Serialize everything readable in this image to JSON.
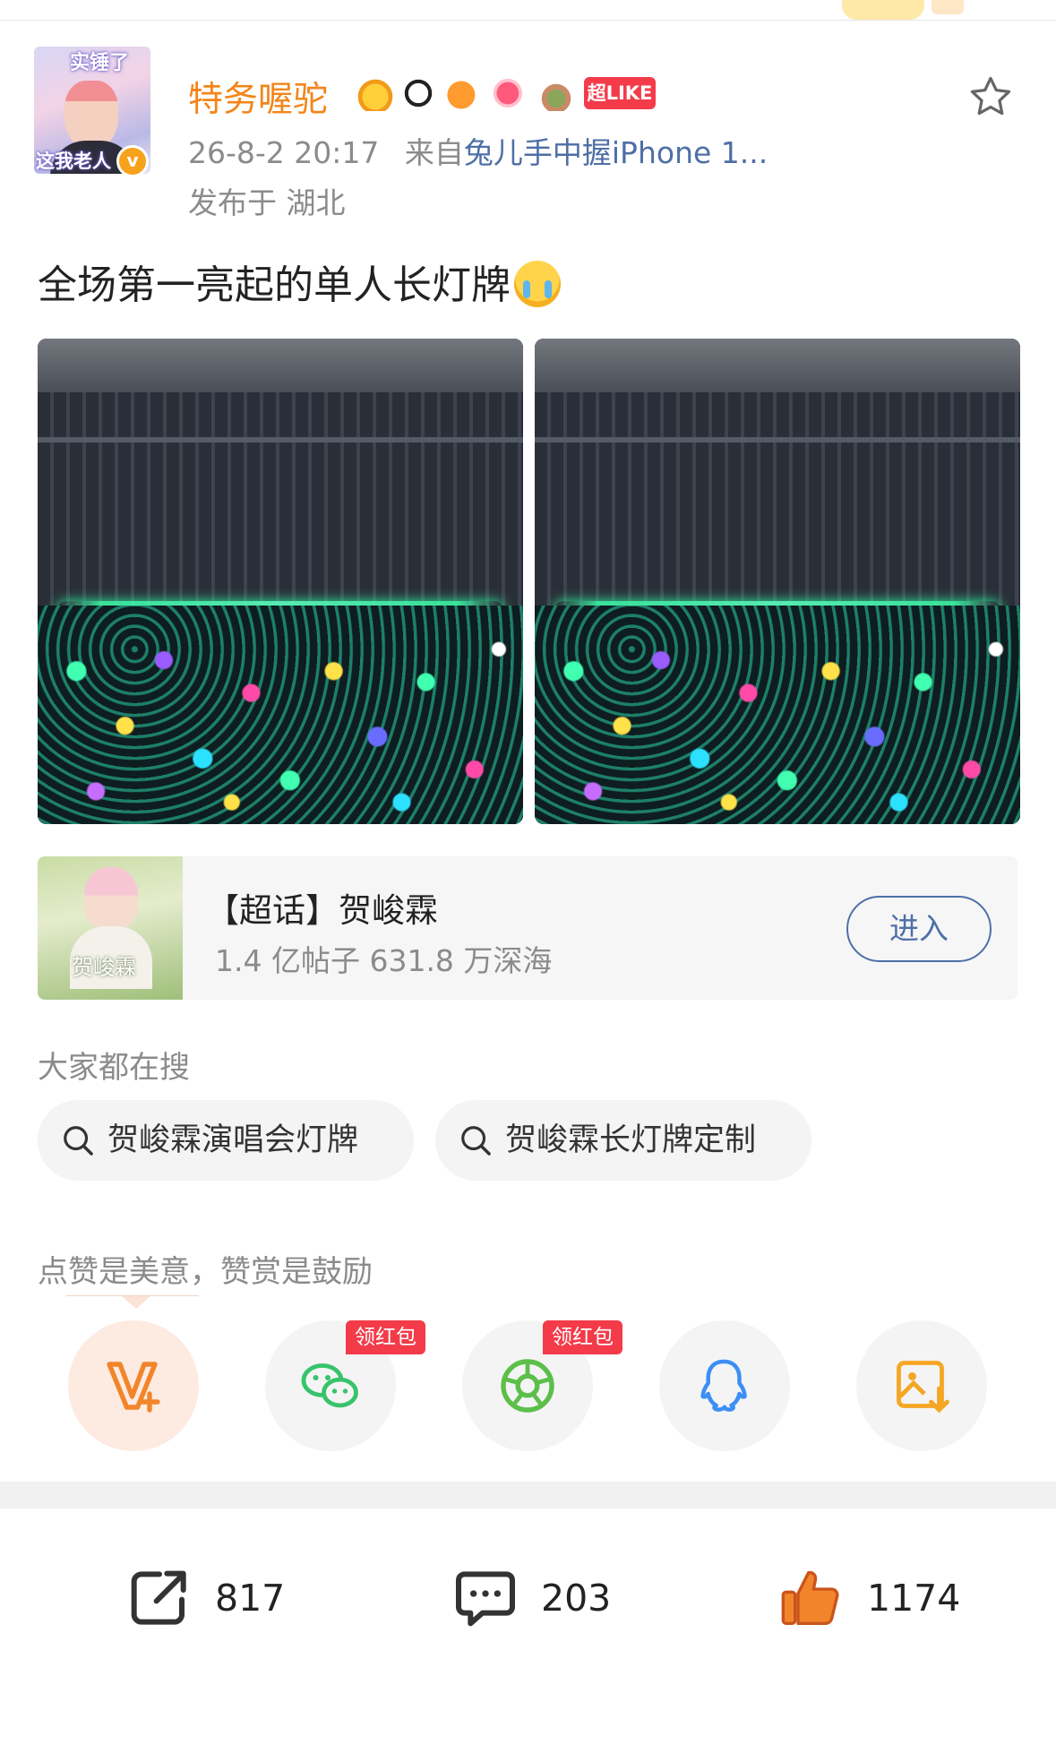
{
  "post": {
    "username": "特务喔驼",
    "super_like_badge": "超LIKE",
    "time": "26-8-2 20:17",
    "source_prefix": "来自",
    "source_device": "兔儿手中握iPhone 1...",
    "location": "发布于 湖北",
    "text": "全场第一亮起的单人长灯牌",
    "avatar_caption_top": "实锤了",
    "avatar_caption_bottom": "这我老人"
  },
  "topic": {
    "title": "【超话】贺峻霖",
    "stats": "1.4 亿帖子 631.8 万深海",
    "enter_label": "进入",
    "image_caption": "贺峻霖"
  },
  "search": {
    "label": "大家都在搜",
    "chips": [
      "贺峻霖演唱会灯牌",
      "贺峻霖长灯牌定制"
    ]
  },
  "share": {
    "praise_text": "点赞是美意，赞赏是鼓励",
    "red_packet_label": "领红包",
    "icons": [
      "reward-v-icon",
      "wechat-icon",
      "moments-icon",
      "qq-icon",
      "save-image-icon"
    ]
  },
  "actions": {
    "reposts": "817",
    "comments": "203",
    "likes": "1174"
  },
  "colors": {
    "username": "#f3851a",
    "link": "#4e6fa6",
    "badge_red": "#f33b4a",
    "like_orange": "#f2852b"
  }
}
